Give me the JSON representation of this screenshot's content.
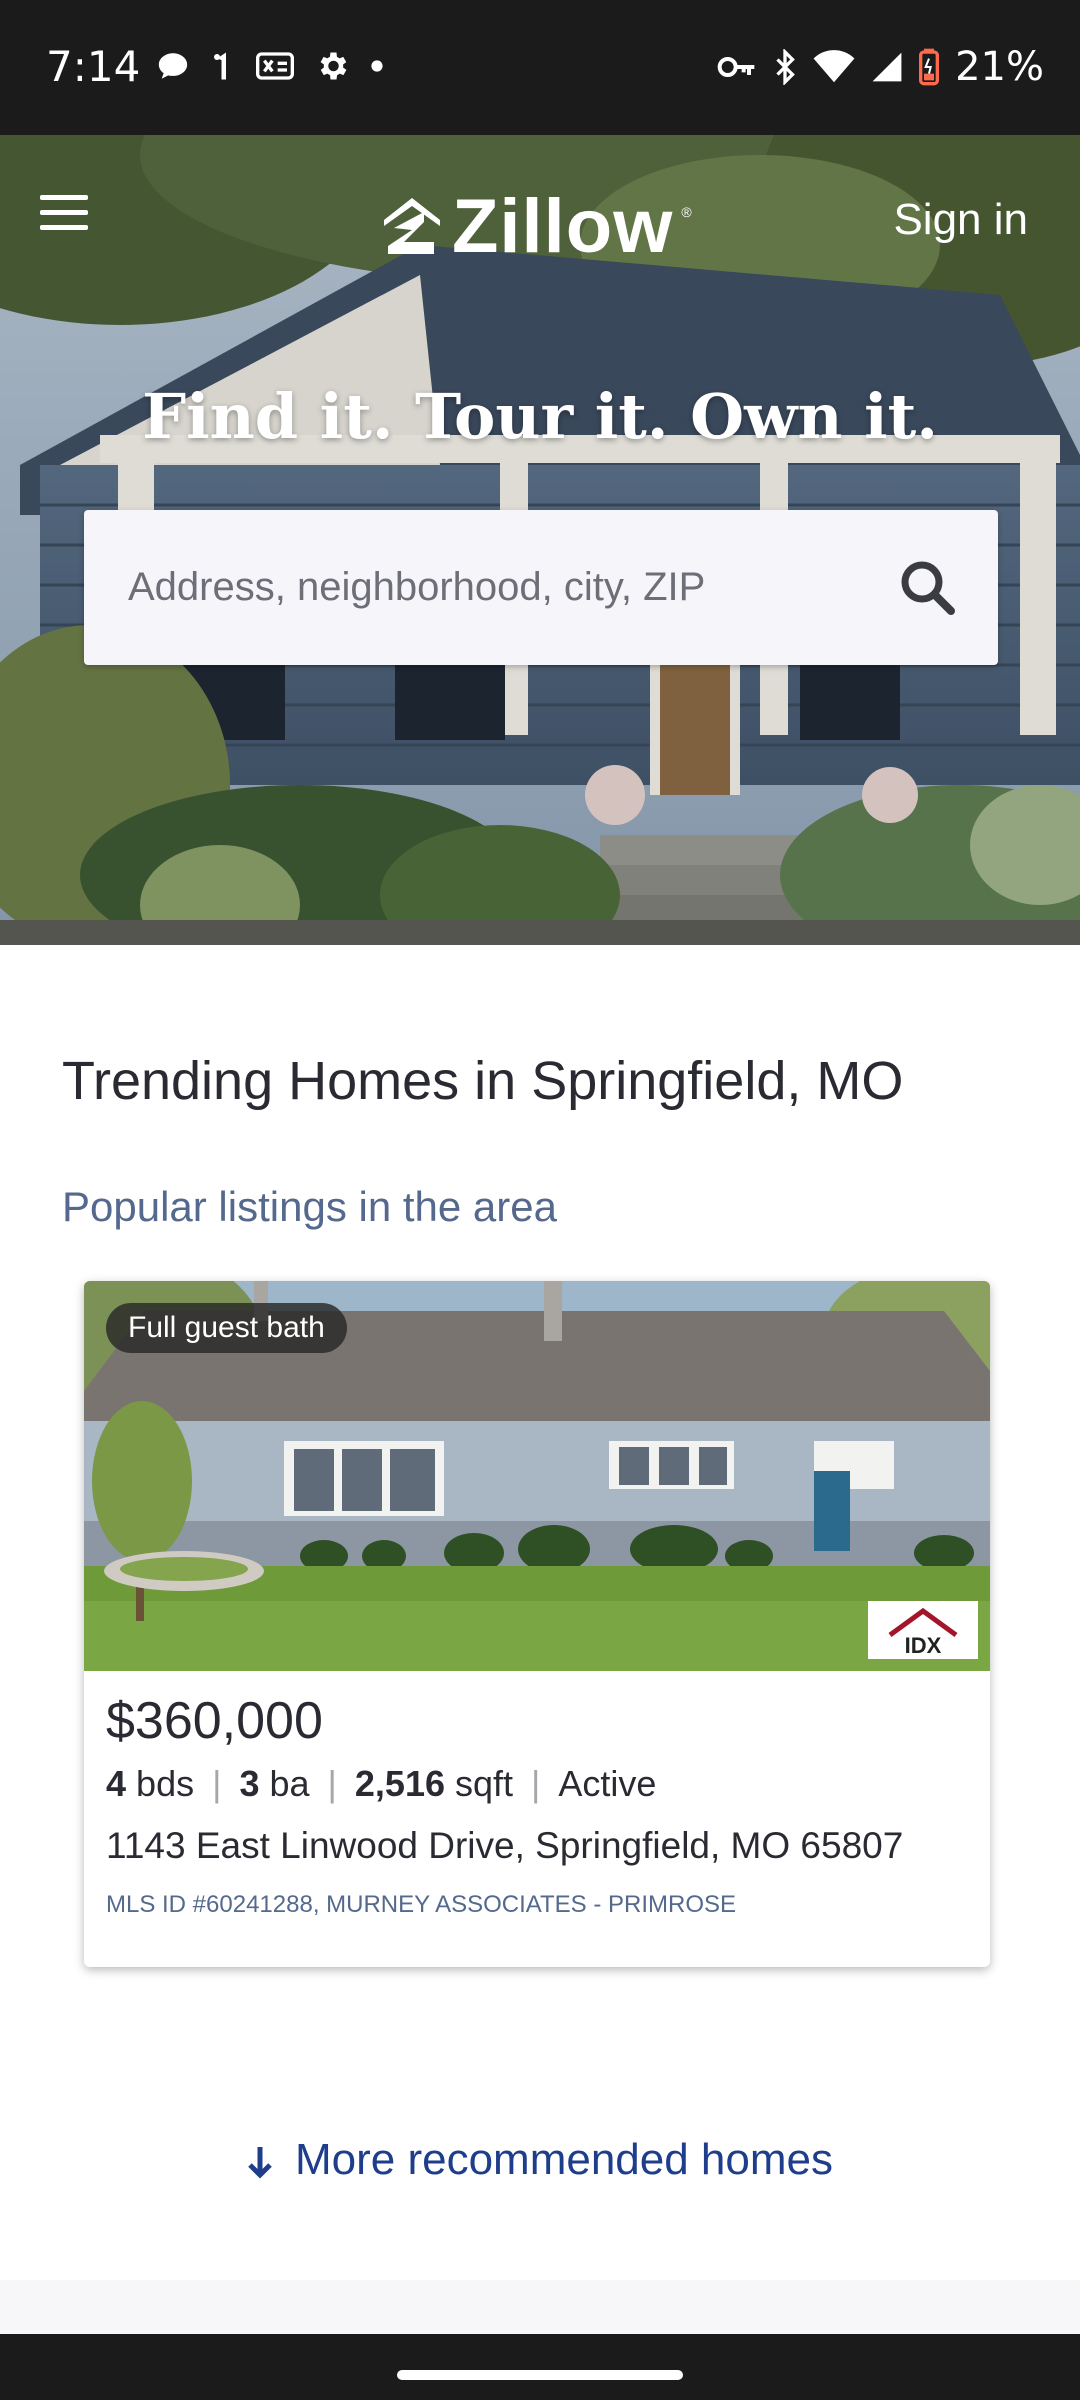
{
  "status_bar": {
    "time": "7:14",
    "battery": "21%",
    "icons_left": [
      "chat-icon",
      "signal-one-icon",
      "sim-icon",
      "gear-icon",
      "dot-icon"
    ],
    "icons_right": [
      "vpn-key-icon",
      "bluetooth-icon",
      "wifi-icon",
      "cell-signal-icon",
      "battery-low-icon"
    ]
  },
  "header": {
    "logo_text": "Zillow",
    "sign_in": "Sign in"
  },
  "hero": {
    "headline": "Find it. Tour it. Own it.",
    "search_placeholder": "Address, neighborhood, city, ZIP"
  },
  "trending": {
    "title": "Trending Homes in Springfield, MO",
    "subtitle": "Popular listings in the area"
  },
  "listing": {
    "badge": "Full guest bath",
    "price": "$360,000",
    "beds": "4",
    "beds_label": "bds",
    "baths": "3",
    "baths_label": "ba",
    "sqft": "2,516",
    "sqft_label": "sqft",
    "status": "Active",
    "address": "1143 East Linwood Drive, Springfield, MO 65807",
    "mls": "MLS ID #60241288, MURNEY ASSOCIATES - PRIMROSE",
    "idx_label": "IDX"
  },
  "more_link": "More recommended homes",
  "colors": {
    "brand_blue": "#006aff",
    "link_blue": "#1e3e8c",
    "subtitle_slate": "#54698d",
    "text_dark": "#2a2a33"
  }
}
